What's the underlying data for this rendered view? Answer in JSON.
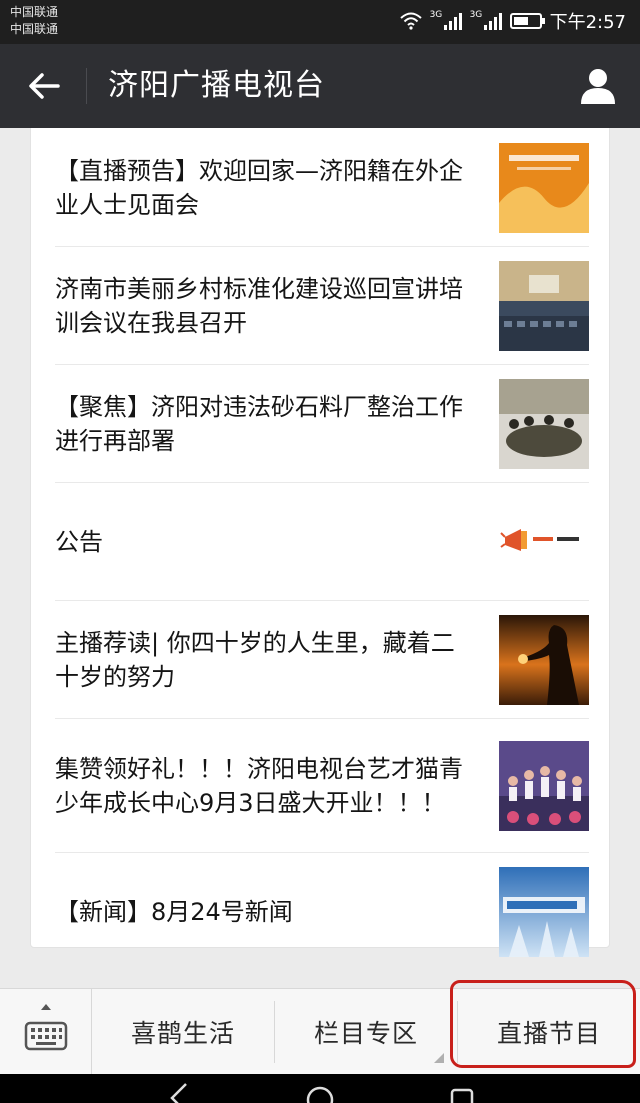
{
  "status_bar": {
    "carrier_1": "中国联通",
    "carrier_2": "中国联通",
    "network_1": "3G",
    "network_2": "3G",
    "time": "下午2:57"
  },
  "title_bar": {
    "title": "济阳广播电视台",
    "back_icon": "arrow-left-icon",
    "profile_icon": "person-icon"
  },
  "articles": [
    {
      "title": "【直播预告】欢迎回家—济阳籍在外企业人士见面会",
      "thumb_colors": [
        "#e8891b",
        "#f6c05a"
      ]
    },
    {
      "title": "济南市美丽乡村标准化建设巡回宣讲培训会议在我县召开",
      "thumb_colors": [
        "#3b4a5e",
        "#c9b48a"
      ]
    },
    {
      "title": "【聚焦】济阳对违法砂石料厂整治工作进行再部署",
      "thumb_colors": [
        "#4d4a3c",
        "#d9d6cf"
      ]
    },
    {
      "title": "公告",
      "thumb_colors": [
        "#ffffff",
        "#e0542a"
      ]
    },
    {
      "title": "主播荐读| 你四十岁的人生里，藏着二十岁的努力",
      "thumb_colors": [
        "#2a1608",
        "#d9731c"
      ]
    },
    {
      "title": "集赞领好礼！！！济阳电视台艺才猫青少年成长中心9月3日盛大开业！！！",
      "thumb_colors": [
        "#5a4a8a",
        "#e7b9a6"
      ]
    },
    {
      "title": "【新闻】8月24号新闻",
      "thumb_colors": [
        "#2f6fb8",
        "#cfe3f5"
      ]
    }
  ],
  "bottom_menu": {
    "keyboard_icon": "keyboard-icon",
    "items": [
      "喜鹊生活",
      "栏目专区",
      "直播节目"
    ]
  },
  "colors": {
    "header_bg": "#2e2f33",
    "annotation_red": "#c8201b"
  }
}
